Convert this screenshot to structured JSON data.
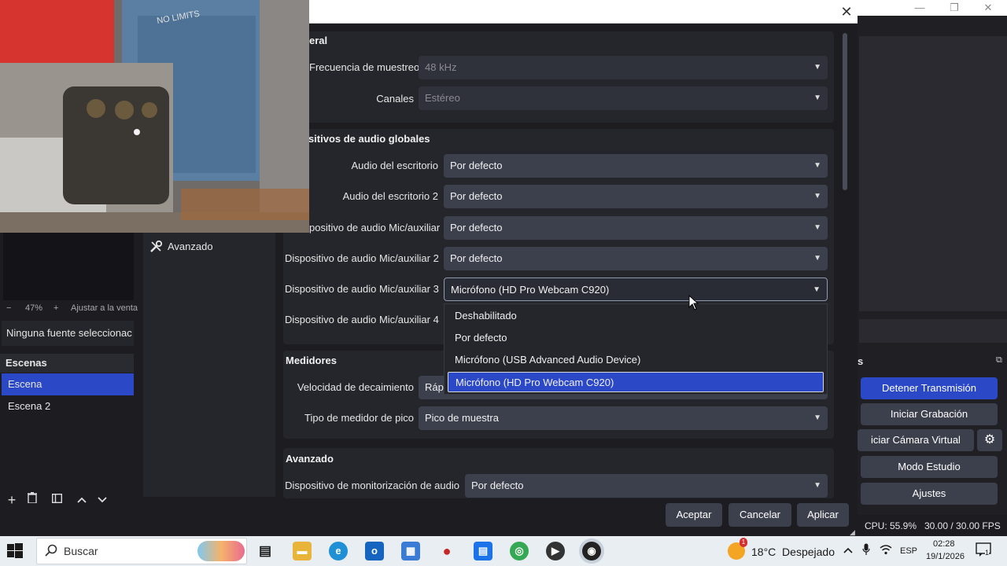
{
  "app": {
    "window_controls": [
      "—",
      "❐",
      "✕"
    ]
  },
  "left_panel": {
    "zoom_minus": "−",
    "zoom_level": "47%",
    "zoom_plus": "+",
    "zoom_fit": "Ajustar a la venta",
    "no_source": "Ninguna fuente seleccionac",
    "scenes_header": "Escenas",
    "scenes": [
      "Escena",
      "Escena 2"
    ]
  },
  "right_panel": {
    "controls_header": "s",
    "buttons": {
      "stop_stream": "Detener Transmisión",
      "start_record": "Iniciar Grabación",
      "virtual_cam": "iciar Cámara Virtual",
      "studio_mode": "Modo Estudio",
      "settings": "Ajustes"
    },
    "cpu": "CPU: 55.9%",
    "fps": "30.00 / 30.00 FPS"
  },
  "dialog": {
    "close": "✕",
    "sidebar_item": "Avanzado",
    "general": {
      "title": "eral",
      "sample_rate_label": "Frecuencia de muestreo",
      "sample_rate_value": "48 kHz",
      "channels_label": "Canales",
      "channels_value": "Estéreo"
    },
    "global_audio": {
      "title": "ositivos de audio globales",
      "rows": [
        {
          "label": "Audio del escritorio",
          "value": "Por defecto"
        },
        {
          "label": "Audio del escritorio 2",
          "value": "Por defecto"
        },
        {
          "label": "positivo de audio Mic/auxiliar",
          "value": "Por defecto"
        },
        {
          "label": "Dispositivo de audio Mic/auxiliar 2",
          "value": "Por defecto"
        },
        {
          "label": "Dispositivo de audio Mic/auxiliar 3",
          "value": "Micrófono (HD Pro Webcam C920)"
        },
        {
          "label": "Dispositivo de audio Mic/auxiliar 4",
          "value": ""
        }
      ]
    },
    "dropdown_options": [
      "Deshabilitado",
      "Por defecto",
      "Micrófono (USB Advanced Audio Device)",
      "Micrófono (HD Pro Webcam C920)"
    ],
    "meters": {
      "title": "Medidores",
      "decay_label": "Velocidad de decaimiento",
      "decay_value": "Ráp",
      "peak_label": "Tipo de medidor de pico",
      "peak_value": "Pico de muestra"
    },
    "advanced": {
      "title": "Avanzado",
      "monitor_label": "Dispositivo de monitorización de audio",
      "monitor_value": "Por defecto"
    },
    "buttons": {
      "ok": "Aceptar",
      "cancel": "Cancelar",
      "apply": "Aplicar"
    }
  },
  "taskbar": {
    "search_placeholder": "Buscar",
    "weather": "18°C  Despejado",
    "lang": "ESP",
    "time": "02:28",
    "date": "19/1/2026",
    "notif_count": "1",
    "weather_badge": "1"
  }
}
